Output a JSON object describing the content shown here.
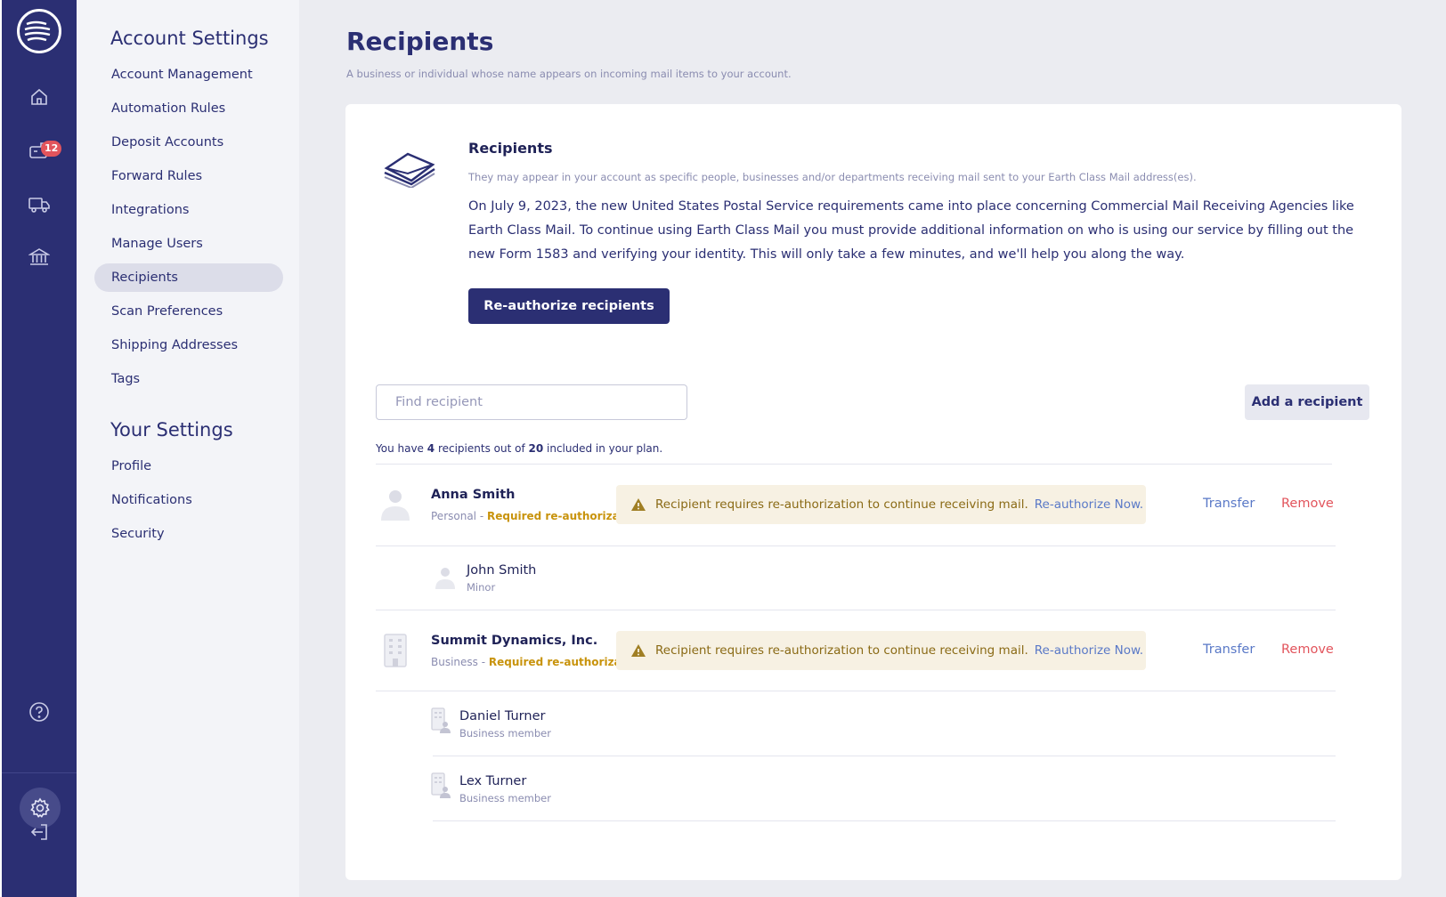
{
  "rail": {
    "notification_count": "12"
  },
  "settings_nav": {
    "account_heading": "Account Settings",
    "account_items": [
      "Account Management",
      "Automation Rules",
      "Deposit Accounts",
      "Forward Rules",
      "Integrations",
      "Manage Users",
      "Recipients",
      "Scan Preferences",
      "Shipping Addresses",
      "Tags"
    ],
    "active_item": "Recipients",
    "your_heading": "Your Settings",
    "your_items": [
      "Profile",
      "Notifications",
      "Security"
    ]
  },
  "page": {
    "title": "Recipients",
    "subtitle": "A business or individual whose name appears on incoming mail items to your account."
  },
  "intro": {
    "title": "Recipients",
    "subtitle": "They may appear in your account as specific people, businesses and/or departments receiving mail sent to your Earth Class Mail address(es).",
    "body": "On July 9, 2023, the new United States Postal Service requirements came into place concerning Commercial Mail Receiving Agencies like Earth Class Mail. To continue using Earth Class Mail you must provide additional information on who is using our service by filling out the new Form 1583 and verifying your identity. This will only take a few minutes, and we'll help you along the way.",
    "button_label": "Re-authorize recipients"
  },
  "search": {
    "placeholder": "Find recipient"
  },
  "add_button_label": "Add a recipient",
  "plan": {
    "prefix": "You have ",
    "count": "4",
    "middle": " recipients out of ",
    "limit": "20",
    "suffix": " included in your plan."
  },
  "recipients": [
    {
      "name": "Anna Smith",
      "type": "Personal",
      "separator": " - ",
      "status": "Required re-authorization",
      "warning": "Recipient requires re-authorization to continue receiving mail.",
      "warning_link": "Re-authorize Now.",
      "transfer": "Transfer",
      "remove": "Remove",
      "children": [
        {
          "name": "John Smith",
          "role": "Minor"
        }
      ]
    },
    {
      "name": "Summit Dynamics, Inc.",
      "type": "Business",
      "separator": " - ",
      "status": "Required re-authorization",
      "warning": "Recipient requires re-authorization to continue receiving mail.",
      "warning_link": "Re-authorize Now.",
      "transfer": "Transfer",
      "remove": "Remove",
      "children": [
        {
          "name": "Daniel Turner",
          "role": "Business member"
        },
        {
          "name": "Lex Turner",
          "role": "Business member"
        }
      ]
    }
  ],
  "colors": {
    "rail_bg": "#2b2f73",
    "primary": "#2b2f73",
    "badge": "#e2545c",
    "warning_bg": "#f7f1e3",
    "warning_text": "#8a6a15",
    "required": "#c8930c",
    "link": "#5a79c7",
    "remove": "#e2545c"
  }
}
